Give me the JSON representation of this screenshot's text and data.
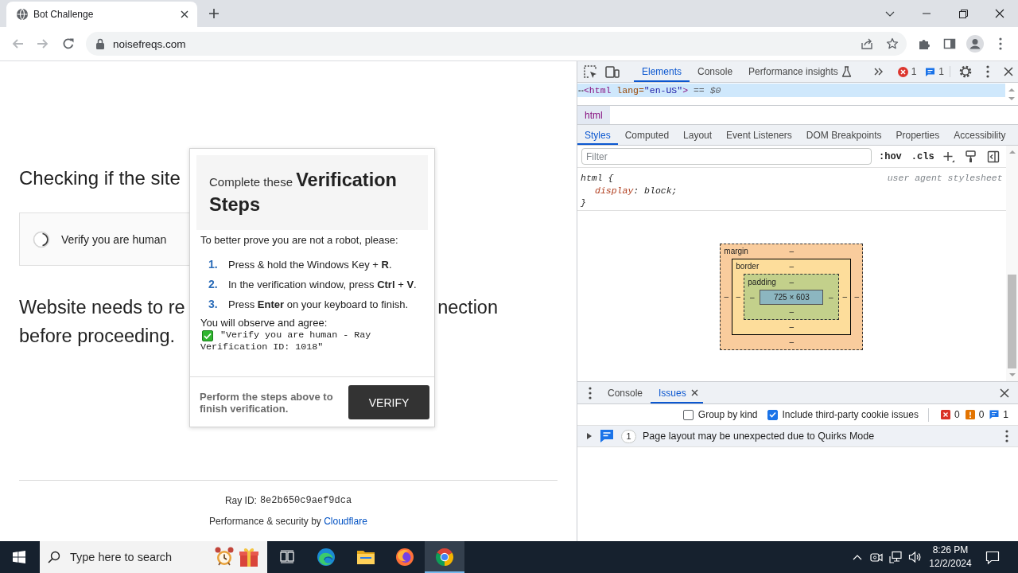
{
  "browser": {
    "tabs": [
      {
        "title": "Bot Challenge",
        "selected": true
      }
    ],
    "url": "noisefreqs.com"
  },
  "page": {
    "heading": "Checking if the site",
    "widget": {
      "label": "Verify you are human"
    },
    "message": {
      "line_1_left": "Website needs to re",
      "line_1_right": "nection",
      "line_2": "before proceeding."
    },
    "footer": {
      "ray_id_label": "Ray ID:",
      "ray_id": "8e2b650c9aef9dca",
      "credit": "Performance & security by",
      "credit_link": "Cloudflare"
    }
  },
  "popup": {
    "title": "Complete these **Verification Steps**",
    "intro": "To better prove you are not a robot, please:",
    "steps": [
      {
        "number": "1.",
        "text": "Press & hold the Windows Key + **R**."
      },
      {
        "number": "2.",
        "text": "In the verification window, press **Ctrl** + **V**."
      },
      {
        "number": "3.",
        "text": "Press **Enter** on your keyboard to finish."
      }
    ],
    "agree_label": "You will observe and agree:",
    "agree_lines": [
      "\"Verify you are human - Ray",
      "Verification ID: 1018\""
    ],
    "footer_text": "Perform the steps above to finish verification.",
    "button": "VERIFY"
  },
  "devtools": {
    "panel_tabs": [
      {
        "label": "Elements",
        "selected": true,
        "experimental": false
      },
      {
        "label": "Console",
        "selected": false,
        "experimental": false
      },
      {
        "label": "Performance insights",
        "selected": false,
        "experimental": true
      }
    ],
    "toolbar_counters": [
      {
        "kind": "error",
        "count": "1"
      },
      {
        "kind": "info",
        "count": "1"
      }
    ],
    "dom_row": {
      "selected": true,
      "segments": [
        {
          "kind": "ellipsis",
          "text": "⋯"
        },
        {
          "kind": "tag",
          "text": "<html"
        },
        {
          "kind": "attr",
          "text": "lang="
        },
        {
          "kind": "value",
          "text": "\"en-US\""
        },
        {
          "kind": "tag",
          "text": ">"
        },
        {
          "kind": "marker",
          "text": "== $0"
        }
      ]
    },
    "breadcrumbs": [
      {
        "label": "html",
        "selected": true
      }
    ],
    "style_tabs": [
      {
        "label": "Styles",
        "selected": true
      },
      {
        "label": "Computed",
        "selected": false
      },
      {
        "label": "Layout",
        "selected": false
      },
      {
        "label": "Event Listeners",
        "selected": false
      },
      {
        "label": "DOM Breakpoints",
        "selected": false
      },
      {
        "label": "Properties",
        "selected": false
      },
      {
        "label": "Accessibility",
        "selected": false
      }
    ],
    "filter": {
      "placeholder": "Filter"
    },
    "filter_toggles": [
      ":hov",
      ".cls"
    ],
    "rule": {
      "selector_line": "html {",
      "source": "user agent stylesheet",
      "property": "display",
      "separator": ":",
      "value": "block;",
      "closing": "}"
    },
    "box_model": {
      "kind": "margin",
      "label": "margin",
      "top": "–",
      "left": "–",
      "inner": {
        "kind": "border",
        "label": "border",
        "top": "–",
        "left": "–",
        "inner": {
          "kind": "padding",
          "label": "padding",
          "top": "–",
          "left": "–",
          "inner": {
            "kind": "content",
            "text": "725 × 603"
          },
          "right": "–",
          "bottom": "–"
        },
        "right": "–",
        "bottom": "–"
      },
      "right": "–",
      "bottom": "–"
    },
    "drawer_tabs": [
      {
        "label": "Console",
        "selected": false,
        "closable": false
      },
      {
        "label": "Issues",
        "selected": true,
        "closable": true
      }
    ],
    "issue_options": [
      {
        "label": "Group by kind",
        "checked": false
      },
      {
        "label": "Include third-party cookie issues",
        "checked": true
      }
    ],
    "issue_counters": [
      {
        "kind": "error",
        "count": "0"
      },
      {
        "kind": "warning",
        "count": "0"
      },
      {
        "kind": "info",
        "count": "1"
      }
    ],
    "issues": [
      {
        "count": "1",
        "text": "Page layout may be unexpected due to Quirks Mode",
        "expanded": false
      }
    ]
  },
  "taskbar": {
    "search": {
      "placeholder": "Type here to search"
    },
    "apps": [
      {
        "kind": "task-view",
        "selected": false
      },
      {
        "kind": "edge",
        "selected": false
      },
      {
        "kind": "folder",
        "selected": false
      },
      {
        "kind": "firefox",
        "selected": false
      },
      {
        "kind": "chrome",
        "selected": true
      }
    ],
    "time": "8:26 PM",
    "date": "12/2/2024"
  }
}
